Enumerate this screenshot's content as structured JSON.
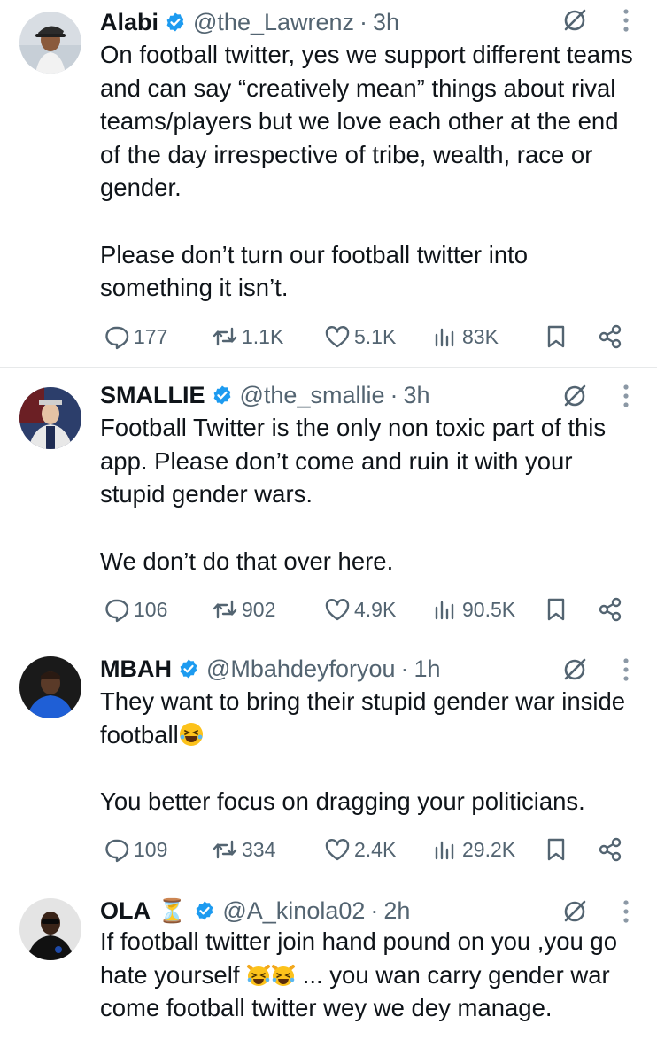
{
  "tweets": [
    {
      "name": "Alabi",
      "handle": "@the_Lawrenz",
      "time": "3h",
      "text": [
        "On football twitter, yes we support different teams and can say “creatively mean” things about rival teams/players but we love each other at the end of the day irrespective of tribe, wealth, race or gender.",
        "Please don’t turn our football twitter into something it isn’t."
      ],
      "replies": "177",
      "reposts": "1.1K",
      "likes": "5.1K",
      "views": "83K"
    },
    {
      "name": "SMALLIE",
      "handle": "@the_smallie",
      "time": "3h",
      "text": [
        "Football Twitter is the only non toxic part of this app. Please don’t come and ruin it with your stupid gender wars.",
        "We don’t do that over here."
      ],
      "replies": "106",
      "reposts": "902",
      "likes": "4.9K",
      "views": "90.5K"
    },
    {
      "name": "MBAH",
      "handle": "@Mbahdeyforyou",
      "time": "1h",
      "text": [
        "They want to bring their stupid gender war inside football",
        "You better focus on dragging your politicians."
      ],
      "replies": "109",
      "reposts": "334",
      "likes": "2.4K",
      "views": "29.2K"
    },
    {
      "name": "OLA",
      "handle": "@A_kinola02",
      "time": "2h",
      "text": [
        "If football twitter join hand pound on you ,you go hate yourself",
        "... you wan carry gender war come football twitter wey we dey manage."
      ]
    }
  ],
  "separator": "·",
  "name_emoji": "⏳",
  "icons": [
    "verified-badge-icon",
    "grok-icon",
    "more-options-icon",
    "reply-icon",
    "repost-icon",
    "like-icon",
    "views-icon",
    "bookmark-icon",
    "share-icon",
    "avatar",
    "laughing-emoji-icon",
    "crying-laughing-cat-emoji-icon"
  ],
  "colors": {
    "text": "#0f1419",
    "secondary": "#536471",
    "verified": "#1d9bf0",
    "divider": "#e7e9ea"
  }
}
